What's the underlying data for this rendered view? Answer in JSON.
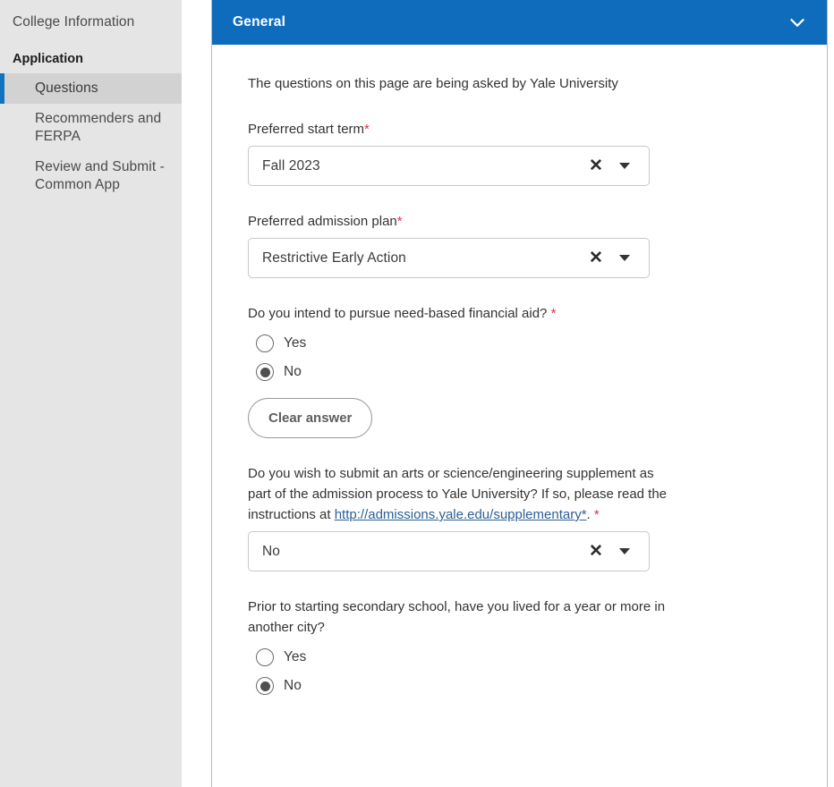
{
  "sidebar": {
    "top_link": "College Information",
    "section_label": "Application",
    "items": [
      {
        "label": "Questions",
        "active": true
      },
      {
        "label": "Recommenders and FERPA",
        "active": false
      },
      {
        "label": "Review and Submit - Common App",
        "active": false
      }
    ]
  },
  "card": {
    "header_title": "General",
    "collapse_icon": "chevron-down-icon",
    "accent_color": "#0f6cbd",
    "intro": "The questions on this page are being asked by Yale University",
    "fields": [
      {
        "type": "select",
        "label": "Preferred start term",
        "required": true,
        "value": "Fall 2023",
        "clear_icon": "close-icon",
        "caret_icon": "chevron-down-icon"
      },
      {
        "type": "select",
        "label": "Preferred admission plan",
        "required": true,
        "value": "Restrictive Early Action",
        "clear_icon": "close-icon",
        "caret_icon": "chevron-down-icon"
      },
      {
        "type": "radio",
        "label": "Do you intend to pursue need-based financial aid?",
        "required": true,
        "options": [
          "Yes",
          "No"
        ],
        "selected": "No",
        "clear_button": "Clear answer"
      },
      {
        "type": "select",
        "label_part1": "Do you wish to submit an arts or science/engineering supplement as part of the admission process to Yale University? If so, please read the instructions at ",
        "link_text": "http://admissions.yale.edu/supplementary*",
        "label_part2": ".",
        "required": true,
        "value": "No",
        "clear_icon": "close-icon",
        "caret_icon": "chevron-down-icon"
      },
      {
        "type": "radio",
        "label": "Prior to starting secondary school, have you lived for a year or more in another city?",
        "required": false,
        "options": [
          "Yes",
          "No"
        ],
        "selected": "No"
      }
    ]
  },
  "colors": {
    "header_blue": "#0f6cbd",
    "sidebar_bg": "#e5e5e5",
    "sidebar_active_bg": "#d2d2d2",
    "sidebar_accent": "#1073bf",
    "required_red": "#d8344b",
    "link_blue": "#2b5f98"
  }
}
